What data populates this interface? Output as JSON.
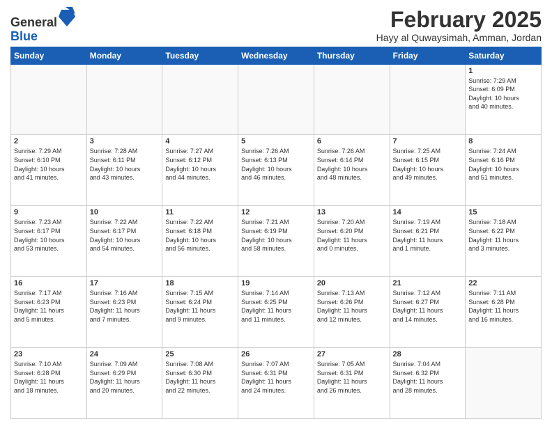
{
  "header": {
    "logo_line1": "General",
    "logo_line2": "Blue",
    "title": "February 2025",
    "subtitle": "Hayy al Quwaysimah, Amman, Jordan"
  },
  "days_of_week": [
    "Sunday",
    "Monday",
    "Tuesday",
    "Wednesday",
    "Thursday",
    "Friday",
    "Saturday"
  ],
  "weeks": [
    [
      {
        "day": "",
        "info": ""
      },
      {
        "day": "",
        "info": ""
      },
      {
        "day": "",
        "info": ""
      },
      {
        "day": "",
        "info": ""
      },
      {
        "day": "",
        "info": ""
      },
      {
        "day": "",
        "info": ""
      },
      {
        "day": "1",
        "info": "Sunrise: 7:29 AM\nSunset: 6:09 PM\nDaylight: 10 hours\nand 40 minutes."
      }
    ],
    [
      {
        "day": "2",
        "info": "Sunrise: 7:29 AM\nSunset: 6:10 PM\nDaylight: 10 hours\nand 41 minutes."
      },
      {
        "day": "3",
        "info": "Sunrise: 7:28 AM\nSunset: 6:11 PM\nDaylight: 10 hours\nand 43 minutes."
      },
      {
        "day": "4",
        "info": "Sunrise: 7:27 AM\nSunset: 6:12 PM\nDaylight: 10 hours\nand 44 minutes."
      },
      {
        "day": "5",
        "info": "Sunrise: 7:26 AM\nSunset: 6:13 PM\nDaylight: 10 hours\nand 46 minutes."
      },
      {
        "day": "6",
        "info": "Sunrise: 7:26 AM\nSunset: 6:14 PM\nDaylight: 10 hours\nand 48 minutes."
      },
      {
        "day": "7",
        "info": "Sunrise: 7:25 AM\nSunset: 6:15 PM\nDaylight: 10 hours\nand 49 minutes."
      },
      {
        "day": "8",
        "info": "Sunrise: 7:24 AM\nSunset: 6:16 PM\nDaylight: 10 hours\nand 51 minutes."
      }
    ],
    [
      {
        "day": "9",
        "info": "Sunrise: 7:23 AM\nSunset: 6:17 PM\nDaylight: 10 hours\nand 53 minutes."
      },
      {
        "day": "10",
        "info": "Sunrise: 7:22 AM\nSunset: 6:17 PM\nDaylight: 10 hours\nand 54 minutes."
      },
      {
        "day": "11",
        "info": "Sunrise: 7:22 AM\nSunset: 6:18 PM\nDaylight: 10 hours\nand 56 minutes."
      },
      {
        "day": "12",
        "info": "Sunrise: 7:21 AM\nSunset: 6:19 PM\nDaylight: 10 hours\nand 58 minutes."
      },
      {
        "day": "13",
        "info": "Sunrise: 7:20 AM\nSunset: 6:20 PM\nDaylight: 11 hours\nand 0 minutes."
      },
      {
        "day": "14",
        "info": "Sunrise: 7:19 AM\nSunset: 6:21 PM\nDaylight: 11 hours\nand 1 minute."
      },
      {
        "day": "15",
        "info": "Sunrise: 7:18 AM\nSunset: 6:22 PM\nDaylight: 11 hours\nand 3 minutes."
      }
    ],
    [
      {
        "day": "16",
        "info": "Sunrise: 7:17 AM\nSunset: 6:23 PM\nDaylight: 11 hours\nand 5 minutes."
      },
      {
        "day": "17",
        "info": "Sunrise: 7:16 AM\nSunset: 6:23 PM\nDaylight: 11 hours\nand 7 minutes."
      },
      {
        "day": "18",
        "info": "Sunrise: 7:15 AM\nSunset: 6:24 PM\nDaylight: 11 hours\nand 9 minutes."
      },
      {
        "day": "19",
        "info": "Sunrise: 7:14 AM\nSunset: 6:25 PM\nDaylight: 11 hours\nand 11 minutes."
      },
      {
        "day": "20",
        "info": "Sunrise: 7:13 AM\nSunset: 6:26 PM\nDaylight: 11 hours\nand 12 minutes."
      },
      {
        "day": "21",
        "info": "Sunrise: 7:12 AM\nSunset: 6:27 PM\nDaylight: 11 hours\nand 14 minutes."
      },
      {
        "day": "22",
        "info": "Sunrise: 7:11 AM\nSunset: 6:28 PM\nDaylight: 11 hours\nand 16 minutes."
      }
    ],
    [
      {
        "day": "23",
        "info": "Sunrise: 7:10 AM\nSunset: 6:28 PM\nDaylight: 11 hours\nand 18 minutes."
      },
      {
        "day": "24",
        "info": "Sunrise: 7:09 AM\nSunset: 6:29 PM\nDaylight: 11 hours\nand 20 minutes."
      },
      {
        "day": "25",
        "info": "Sunrise: 7:08 AM\nSunset: 6:30 PM\nDaylight: 11 hours\nand 22 minutes."
      },
      {
        "day": "26",
        "info": "Sunrise: 7:07 AM\nSunset: 6:31 PM\nDaylight: 11 hours\nand 24 minutes."
      },
      {
        "day": "27",
        "info": "Sunrise: 7:05 AM\nSunset: 6:31 PM\nDaylight: 11 hours\nand 26 minutes."
      },
      {
        "day": "28",
        "info": "Sunrise: 7:04 AM\nSunset: 6:32 PM\nDaylight: 11 hours\nand 28 minutes."
      },
      {
        "day": "",
        "info": ""
      }
    ]
  ]
}
